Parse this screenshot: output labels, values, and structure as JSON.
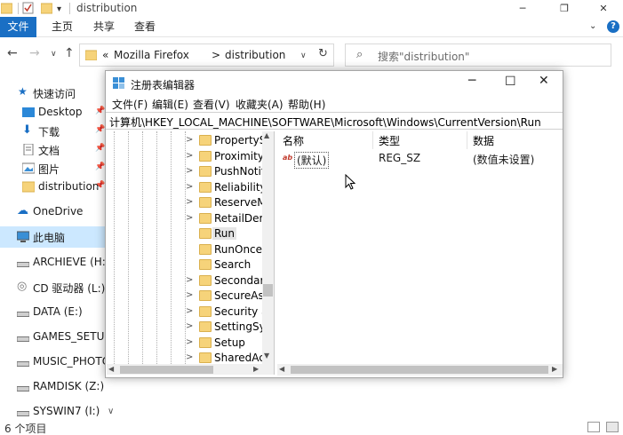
{
  "explorer": {
    "title": "distribution",
    "ribbon_tabs": {
      "file": "文件",
      "home": "主页",
      "share": "共享",
      "view": "查看"
    },
    "address": {
      "crumb_prefix": "«",
      "crumb_1": "Mozilla Firefox",
      "crumb_sep": ">",
      "crumb_2": "distribution"
    },
    "search_placeholder": "搜索\"distribution\"",
    "sidebar": {
      "quick_access": "快速访问",
      "desktop": "Desktop",
      "downloads": "下载",
      "documents": "文档",
      "pictures": "图片",
      "distribution": "distribution",
      "onedrive": "OneDrive",
      "this_pc": "此电脑",
      "drive_h": "ARCHIEVE (H:)",
      "drive_l": "CD 驱动器 (L:) TF",
      "drive_e": "DATA (E:)",
      "drive_g": "GAMES_SETUP (",
      "drive_music": "MUSIC_PHOTO (",
      "drive_z": "RAMDISK (Z:)",
      "drive_i": "SYSWIN7 (I:)"
    },
    "status": "6 个项目"
  },
  "regedit": {
    "title": "注册表编辑器",
    "menu": {
      "file": "文件(F)",
      "edit": "编辑(E)",
      "view": "查看(V)",
      "favorites": "收藏夹(A)",
      "help": "帮助(H)"
    },
    "path": "计算机\\HKEY_LOCAL_MACHINE\\SOFTWARE\\Microsoft\\Windows\\CurrentVersion\\Run",
    "tree_nodes": [
      "PropertySy",
      "Proximity",
      "PushNotifi",
      "Reliability",
      "ReserveM",
      "RetailDem",
      "Run",
      "RunOnce",
      "Search",
      "Secondary",
      "SecureAss",
      "Security ar",
      "SettingSyn",
      "Setup",
      "SharedAcc"
    ],
    "selected_node": "Run",
    "columns": {
      "name": "名称",
      "type": "类型",
      "data": "数据"
    },
    "values": [
      {
        "icon": "ab",
        "name": "(默认)",
        "type": "REG_SZ",
        "data": "(数值未设置)"
      }
    ]
  }
}
